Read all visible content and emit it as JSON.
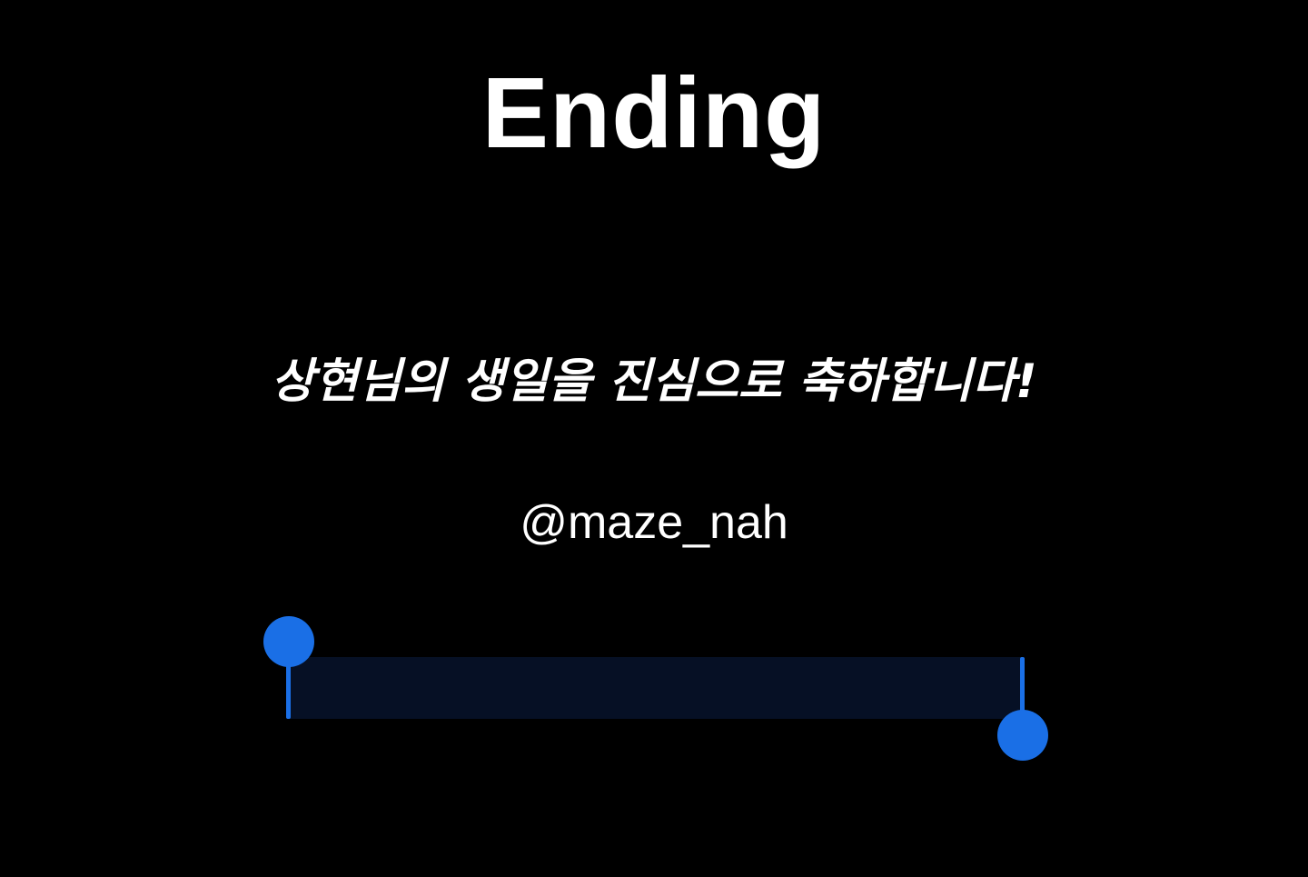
{
  "slide": {
    "title": "Ending",
    "message": "상현님의 생일을 진심으로 축하합니다!",
    "handle": "@maze_nah"
  },
  "selection": {
    "start_handle_icon": "circle-handle",
    "end_handle_icon": "circle-handle"
  },
  "colors": {
    "background": "#000000",
    "text": "#ffffff",
    "accent": "#1a6fe6",
    "selection_band": "#061025"
  }
}
